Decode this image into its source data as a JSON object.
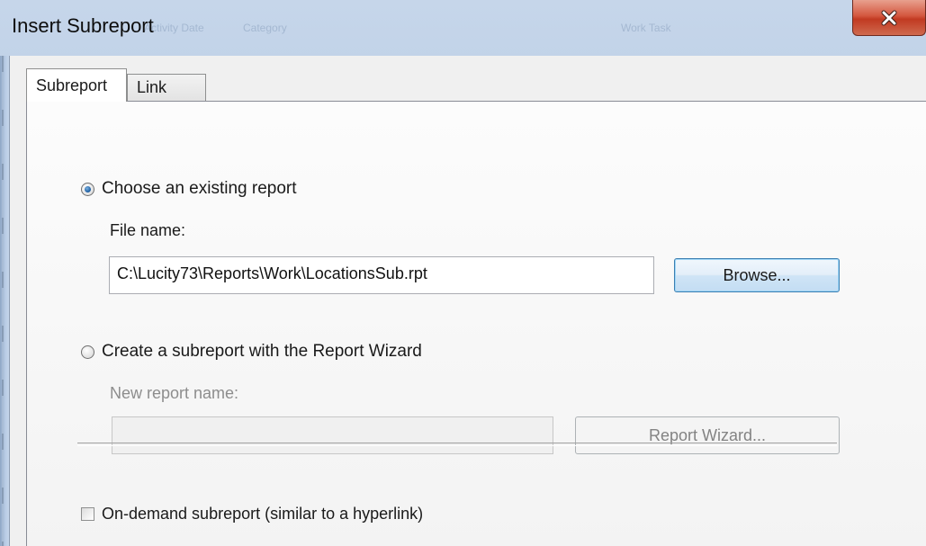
{
  "window": {
    "title": "Insert Subreport",
    "close_glyph": "✕",
    "background_window_text": [
      "Activity Date",
      "Category",
      "Work Task"
    ]
  },
  "tabs": [
    {
      "label": "Subreport",
      "active": true
    },
    {
      "label": "Link",
      "active": false
    }
  ],
  "existing": {
    "radio_label": "Choose an existing report",
    "selected": true,
    "file_label": "File name:",
    "file_value": "C:\\Lucity73\\Reports\\Work\\LocationsSub.rpt",
    "browse_label": "Browse..."
  },
  "wizard": {
    "radio_label": "Create a subreport with the Report Wizard",
    "selected": false,
    "name_label": "New report name:",
    "name_value": "",
    "wizard_button_label": "Report Wizard..."
  },
  "on_demand": {
    "label": "On-demand subreport (similar to a hyperlink)",
    "checked": false
  },
  "colors": {
    "titlebar": "#b7cbe4",
    "close_button": "#c13a22",
    "default_button_border": "#3c7fb1"
  }
}
